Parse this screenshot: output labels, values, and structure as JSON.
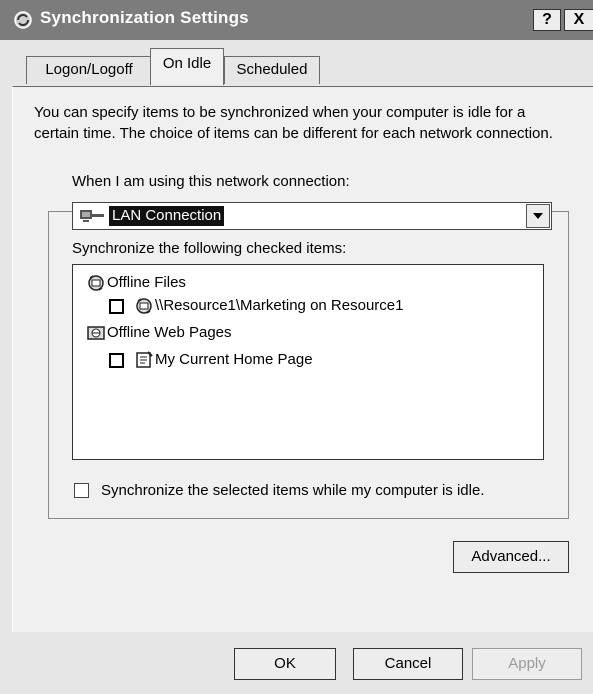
{
  "window": {
    "title": "Synchronization Settings",
    "help_label": "?",
    "close_label": "X"
  },
  "tabs": [
    {
      "label": "Logon/Logoff",
      "active": false
    },
    {
      "label": "On Idle",
      "active": true
    },
    {
      "label": "Scheduled",
      "active": false
    }
  ],
  "content": {
    "description": "You can specify items to be synchronized when your computer is idle for a certain time.  The choice of items can be different for each network connection.",
    "connection_label": "When I am using this network connection:",
    "connection_value": "LAN Connection",
    "items_label": "Synchronize the following checked items:",
    "items": [
      {
        "label": "Offline Files",
        "icon": "offline-files-icon",
        "level": 0,
        "checkbox": false
      },
      {
        "label": "\\\\Resource1\\Marketing on Resource1",
        "icon": "shared-folder-icon",
        "level": 1,
        "checkbox": true,
        "checked": false
      },
      {
        "label": "Offline Web Pages",
        "icon": "web-pages-icon",
        "level": 0,
        "checkbox": false
      },
      {
        "label": "My Current Home Page",
        "icon": "web-page-icon",
        "level": 1,
        "checkbox": true,
        "checked": false
      }
    ],
    "idle_checkbox_label": "Synchronize the selected items while my computer is idle.",
    "idle_checked": false,
    "advanced_label": "Advanced..."
  },
  "footer": {
    "ok_label": "OK",
    "cancel_label": "Cancel",
    "apply_label": "Apply",
    "apply_enabled": false
  }
}
